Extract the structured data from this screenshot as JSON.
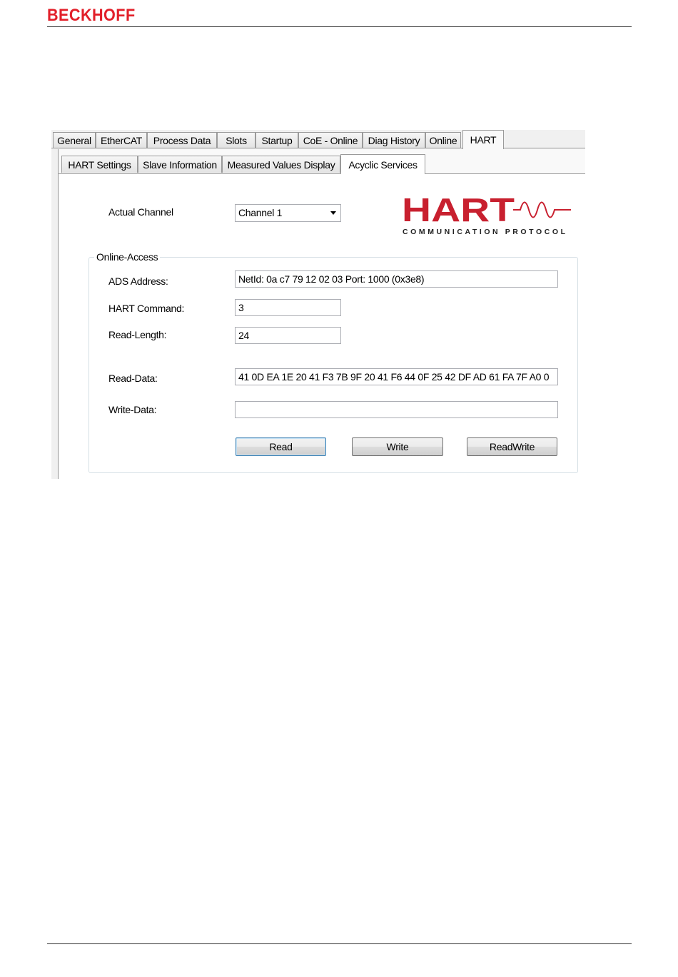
{
  "brand": "BECKHOFF",
  "tabs_main": [
    "General",
    "EtherCAT",
    "Process Data",
    "Slots",
    "Startup",
    "CoE - Online",
    "Diag History",
    "Online",
    "HART"
  ],
  "tabs_sub": [
    "HART Settings",
    "Slave Information",
    "Measured Values Display",
    "Acyclic Services"
  ],
  "channel": {
    "label": "Actual Channel",
    "value": "Channel 1"
  },
  "logo": {
    "word": "HART",
    "tagline": "COMMUNICATION PROTOCOL",
    "color": "#c8202f"
  },
  "online_access": {
    "title": "Online-Access",
    "ads_label": "ADS Address:",
    "ads_value": "NetId: 0a c7 79 12 02 03    Port: 1000 (0x3e8)",
    "cmd_label": "HART Command:",
    "cmd_value": "3",
    "len_label": "Read-Length:",
    "len_value": "24",
    "read_label": "Read-Data:",
    "read_value": "41 0D EA 1E 20 41 F3 7B 9F 20 41 F6 44 0F 25 42 DF AD 61 FA 7F A0 0",
    "write_label": "Write-Data:",
    "write_value": ""
  },
  "buttons": {
    "read": "Read",
    "write": "Write",
    "readwrite": "ReadWrite"
  }
}
